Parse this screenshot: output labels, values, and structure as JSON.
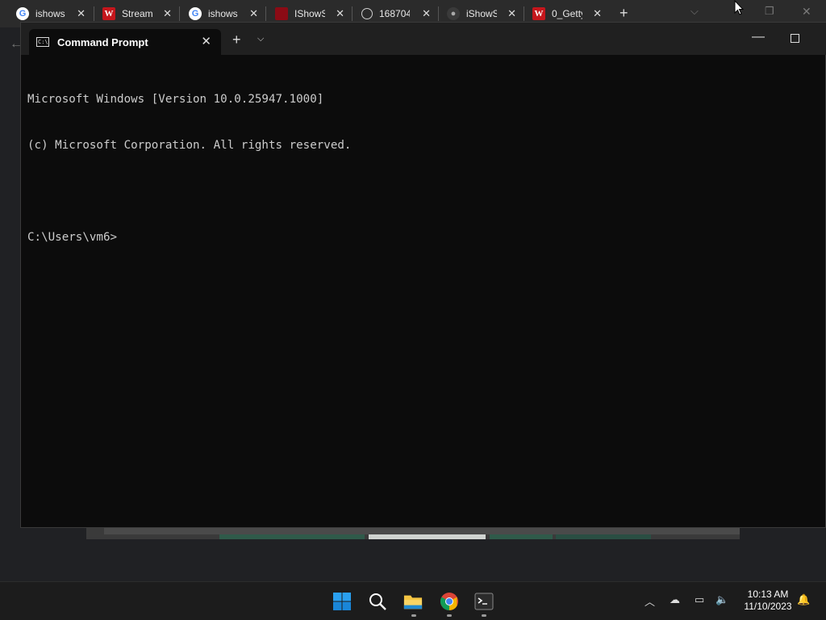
{
  "browser": {
    "tabs": [
      {
        "title": "ishows",
        "icon": "google-icon"
      },
      {
        "title": "Stream",
        "icon": "w-logo-icon"
      },
      {
        "title": "ishows",
        "icon": "google-icon"
      },
      {
        "title": "IShowS",
        "icon": "red-square-icon"
      },
      {
        "title": "168704",
        "icon": "globe-icon"
      },
      {
        "title": "iShowS",
        "icon": "github-icon"
      },
      {
        "title": "0_Getty",
        "icon": "w-logo-icon"
      }
    ],
    "close_glyph": "✕",
    "new_tab_glyph": "+"
  },
  "terminal": {
    "tab_title": "Command Prompt",
    "close_glyph": "✕",
    "new_tab_glyph": "+",
    "dropdown_glyph": "⌵",
    "minimize_glyph": "—",
    "console_lines": [
      "Microsoft Windows [Version 10.0.25947.1000]",
      "(c) Microsoft Corporation. All rights reserved.",
      "",
      "C:\\Users\\vm6>"
    ]
  },
  "taskbar": {
    "pinned": [
      {
        "name": "start-icon"
      },
      {
        "name": "search-icon"
      },
      {
        "name": "file-explorer-icon"
      },
      {
        "name": "chrome-icon"
      },
      {
        "name": "terminal-icon"
      }
    ],
    "clock": {
      "time": "10:13 AM",
      "date": "11/10/2023"
    }
  },
  "colors": {
    "terminal_bg": "#0c0c0c",
    "terminal_text": "#cccccc",
    "accent": "#0078d4"
  }
}
